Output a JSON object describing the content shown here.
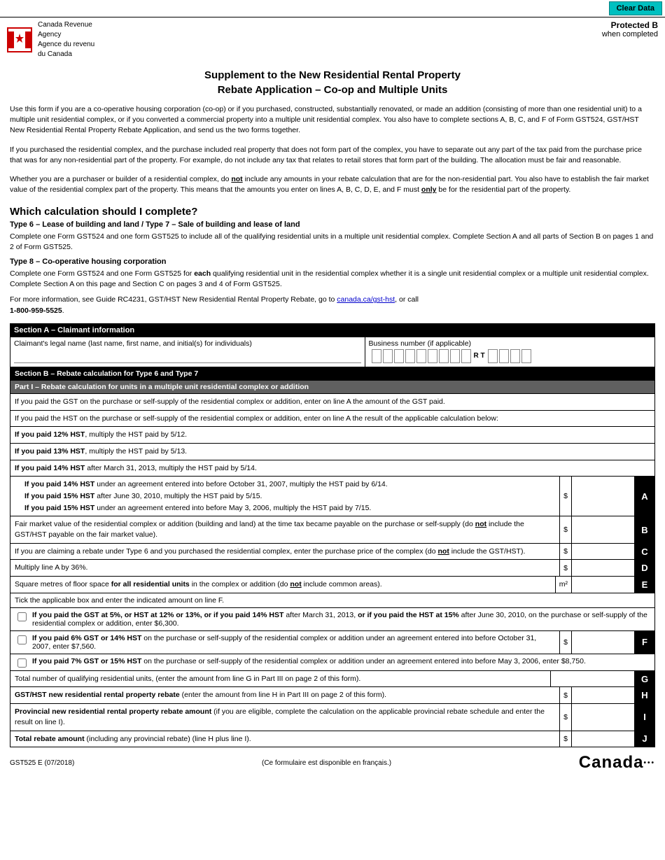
{
  "topbar": {
    "clear_data_label": "Clear Data"
  },
  "header": {
    "agency_en": "Canada Revenue",
    "agency_en2": "Agency",
    "agency_fr": "Agence du revenu",
    "agency_fr2": "du Canada",
    "protected": "Protected B",
    "when_completed": "when completed"
  },
  "title": {
    "line1": "Supplement to the New Residential Rental Property",
    "line2": "Rebate Application – Co-op and Multiple Units"
  },
  "intro": {
    "para1": "Use this form if you are a co-operative housing corporation (co-op) or if you purchased, constructed, substantially renovated, or made an addition (consisting of more than one residential unit) to a multiple unit residential complex, or if you converted a commercial property into a multiple unit residential complex. You also have to complete sections A, B, C, and F of Form GST524, GST/HST New Residential Rental Property Rebate Application, and send us the two forms together.",
    "para2": "If you purchased the residential complex, and the purchase included real property that does not form part of the complex, you have to separate out any part of the tax paid from the purchase price that was for any non-residential part of the property. For example, do not include any tax that relates to retail stores that form part of the building. The allocation must be fair and reasonable.",
    "para3_pre": "Whether you are a purchaser or builder of a residential complex, do ",
    "para3_not": "not",
    "para3_post": " include any amounts in your rebate calculation that are for the non-residential part. You also have to establish the fair market value of the residential complex part of the property. This means that the amounts you enter on lines A, B, C, D, E, and F must ",
    "para3_only": "only",
    "para3_end": " be for the residential part of the property."
  },
  "which_calc": {
    "heading": "Which calculation should I complete?",
    "type67_heading": "Type 6 – Lease of building and land / Type 7 – Sale of building and lease of land",
    "type67_body": "Complete one Form GST524 and one form GST525 to include all of the qualifying residential units in a multiple unit residential complex. Complete Section A and all parts of Section B on pages 1 and 2 of Form GST525.",
    "type8_heading": "Type 8 – Co-operative housing corporation",
    "type8_body_pre": "Complete one Form GST524 and one Form GST525 for ",
    "type8_body_bold": "each",
    "type8_body_post": " qualifying residential unit in the residential complex whether it is a single unit residential complex or a multiple unit residential complex. Complete Section A on this page and Section C on pages 3 and 4 of Form GST525.",
    "more_info_pre": "For more information, see Guide RC4231, GST/HST New Residential Rental Property Rebate, go to ",
    "more_info_link": "canada.ca/gst-hst",
    "more_info_post": ", or call",
    "phone": "1-800-959-5525",
    "phone_suffix": "."
  },
  "section_a": {
    "label": "Section A – Claimant information",
    "claimant_name_label": "Claimant's legal name (last name, first name, and initial(s) for individuals)",
    "business_number_label": "Business number (if applicable)",
    "rt_label": "R T"
  },
  "section_b": {
    "label": "Section B – Rebate calculation for Type 6 and Type 7",
    "part1_label": "Part I – Rebate calculation for units in a multiple unit residential complex or addition",
    "gst_paid_text": "If you paid the GST on the purchase or self-supply of the residential complex or addition, enter on line A the amount of the GST paid.",
    "hst_paid_text": "If you paid the HST on the purchase or self-supply of the residential complex or addition, enter on line A the result of the applicable calculation below:",
    "hst12": "If you paid 12% HST, multiply the HST paid by 5/12.",
    "hst13": "If you paid 13% HST, multiply the HST paid by 5/13.",
    "hst14a": "If you paid 14% HST after March 31, 2013, multiply the HST paid by 5/14.",
    "hst14b": "If you paid 14% HST under an agreement entered into before October 31, 2007, multiply the HST paid by 6/14.",
    "hst15a": "If you paid 15% HST after June 30, 2010, multiply the HST paid by 5/15.",
    "hst15b": "If you paid 15% HST under an agreement entered into before May 3, 2006, multiply the HST paid by 7/15.",
    "line_A_letter": "A",
    "fair_market_value_text": "Fair market value of the residential complex or addition (building and land) at the time tax became payable on the purchase or self-supply (do not include the GST/HST payable on the fair market value).",
    "line_B_letter": "B",
    "purchase_price_text": "If you are claiming a rebate under Type 6 and you purchased the residential complex, enter the purchase price of the complex (do not include the GST/HST).",
    "line_C_letter": "C",
    "multiply_text": "Multiply line A by 36%.",
    "line_D_letter": "D",
    "floor_space_text": "Square metres of floor space for all residential units in the complex or addition (do not include common areas).",
    "floor_space_unit": "m²",
    "line_E_letter": "E",
    "tick_box_text": "Tick the applicable box and enter the indicated amount on line F.",
    "checkbox1_text": "If you paid the GST at 5%, or HST at 12% or 13%, or if you paid 14% HST after March 31, 2013, or if you paid the HST at 15% after June 30, 2010, on the purchase or self-supply of the residential complex or addition, enter $6,300.",
    "checkbox2_text": "If you paid 6% GST or 14% HST on the purchase or self-supply of the residential complex or addition under an agreement entered into before October 31, 2007, enter $7,560.",
    "checkbox3_text": "If you paid 7% GST or 15% HST on the purchase or self-supply of the residential complex or addition under an agreement entered into before May 3, 2006, enter $8,750.",
    "line_F_letter": "F",
    "qualifying_units_text": "Total number of qualifying residential units, (enter the amount from line G in Part III on page 2 of this form).",
    "line_G_letter": "G",
    "gst_hst_rebate_text": "GST/HST new residential rental property rebate (enter the amount from line H in Part III on page 2 of this form).",
    "line_H_letter": "H",
    "provincial_rebate_text": "Provincial new residential rental property rebate amount (if you are eligible, complete the calculation on the applicable provincial rebate schedule and enter the result on line I).",
    "line_I_letter": "I",
    "total_rebate_text": "Total rebate amount (including any provincial rebate) (line H plus line I).",
    "line_J_letter": "J"
  },
  "footer": {
    "form_number": "GST525 E (07/2018)",
    "french_note": "(Ce formulaire est disponible en français.)",
    "canada_wordmark": "Canada"
  }
}
